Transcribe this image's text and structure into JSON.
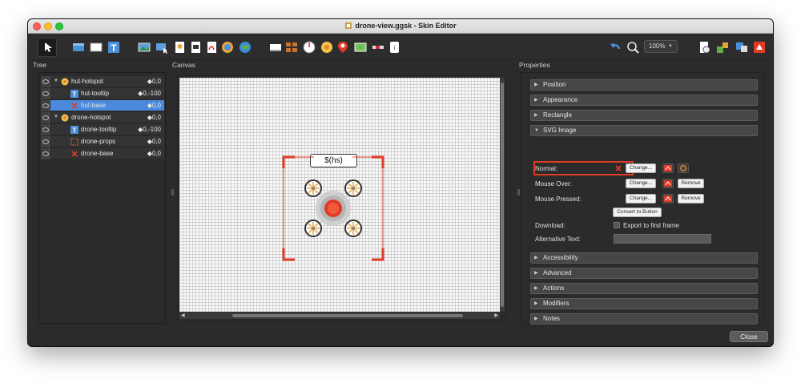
{
  "window": {
    "title": "drone-view.ggsk - Skin Editor"
  },
  "toolbar": {
    "zoom": "100%",
    "icons": [
      "select-tool-icon",
      "rectangle-blue-icon",
      "rectangle-white-icon",
      "text-icon",
      "image-icon",
      "button-image-icon",
      "svg-icon",
      "video-icon",
      "pdf-icon",
      "map-icon",
      "cloud-map-icon",
      "frame-icon",
      "cloner-icon",
      "compass-icon",
      "sun-icon",
      "map-pin-icon",
      "map-rect-icon",
      "scrollbar-icon",
      "hotspot-icon",
      "undo-icon",
      "inspect-icon",
      "viewer-icon",
      "tools-icon",
      "translate-icon",
      "tour-icon"
    ]
  },
  "panels": {
    "tree": "Tree",
    "canvas": "Canvas",
    "properties": "Properties"
  },
  "tree": {
    "rows": [
      {
        "label": "hut-hotspot",
        "pos": "◆0,0"
      },
      {
        "label": "hut-tooltip",
        "pos": "◆0,-100"
      },
      {
        "label": "hut-base",
        "pos": "◆0,0"
      },
      {
        "label": "drone-hotspot",
        "pos": "◆0,0"
      },
      {
        "label": "drone-tooltip",
        "pos": "◆0,-100"
      },
      {
        "label": "drone-props",
        "pos": "◆0,0"
      },
      {
        "label": "drone-base",
        "pos": "◆0,0"
      }
    ]
  },
  "canvas": {
    "tooltip_text": "$(hs)"
  },
  "properties": {
    "sections_top": [
      "Position",
      "Appearance",
      "Rectangle",
      "SVG Image"
    ],
    "sections_bottom": [
      "Accessibility",
      "Advanced",
      "Actions",
      "Modifiers",
      "Notes"
    ],
    "svg": {
      "normal_label": "Normal:",
      "mouse_over_label": "Mouse Over:",
      "mouse_pressed_label": "Mouse Pressed:",
      "change": "Change...",
      "remove": "Remove",
      "convert": "Convert to Button",
      "download_label": "Download:",
      "export_label": "Export to first frame",
      "alt_text_label": "Alternative Text:"
    }
  },
  "footer": {
    "close": "Close"
  },
  "colors": {
    "accent_red": "#e13b25",
    "selection_blue": "#4a89dc"
  }
}
